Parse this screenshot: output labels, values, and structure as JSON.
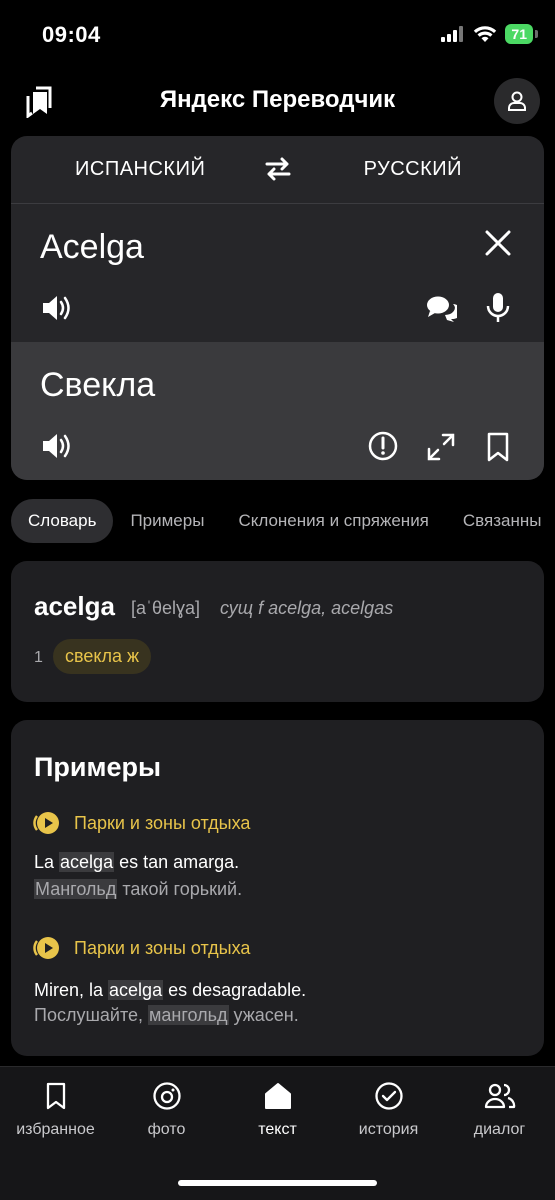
{
  "status": {
    "time": "09:04",
    "battery": "71"
  },
  "header": {
    "title": "Яндекс Переводчик",
    "left_icon": "bookmarks-icon",
    "right_icon": "profile-icon"
  },
  "translator": {
    "source_lang": "ИСПАНСКИЙ",
    "target_lang": "РУССКИЙ",
    "source_text": "Acelga",
    "target_text": "Свекла"
  },
  "tabs": [
    {
      "label": "Словарь",
      "active": true
    },
    {
      "label": "Примеры",
      "active": false
    },
    {
      "label": "Склонения и спряжения",
      "active": false
    },
    {
      "label": "Связанны",
      "active": false
    }
  ],
  "dictionary": {
    "word": "acelga",
    "transcription": "[aˈθelɣa]",
    "pos": "сущ f acelga, acelgas",
    "entries": [
      {
        "num": "1",
        "translation": "свекла",
        "gender": "ж"
      }
    ]
  },
  "examples": {
    "title": "Примеры",
    "items": [
      {
        "source": "Парки и зоны отдыха",
        "es_before": "La ",
        "es_hl": "acelga",
        "es_after": " es tan amarga.",
        "ru_before": "",
        "ru_hl": "Мангольд",
        "ru_after": " такой горький."
      },
      {
        "source": "Парки и зоны отдыха",
        "es_before": "Miren, la ",
        "es_hl": "acelga",
        "es_after": " es desagradable.",
        "ru_before": "Послушайте, ",
        "ru_hl": "мангольд",
        "ru_after": " ужасен."
      }
    ]
  },
  "bottom_nav": [
    {
      "label": "избранное",
      "icon": "bookmark-icon"
    },
    {
      "label": "фото",
      "icon": "camera-icon"
    },
    {
      "label": "текст",
      "icon": "home-icon"
    },
    {
      "label": "история",
      "icon": "history-icon"
    },
    {
      "label": "диалог",
      "icon": "dialog-icon"
    }
  ],
  "colors": {
    "accent": "#e8c44a",
    "card": "#262629",
    "background": "#000000"
  }
}
